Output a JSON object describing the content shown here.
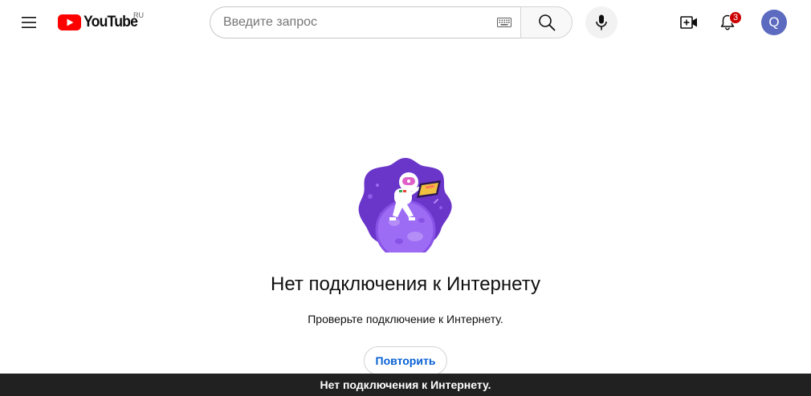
{
  "header": {
    "logo_text": "YouTube",
    "country_code": "RU",
    "search": {
      "placeholder": "Введите запрос",
      "value": ""
    },
    "notifications_count": "3",
    "avatar_letter": "Q"
  },
  "main": {
    "title": "Нет подключения к Интернету",
    "message": "Проверьте подключение к Интернету.",
    "retry_label": "Повторить"
  },
  "snackbar": {
    "text": "Нет подключения к Интернету."
  },
  "icons": {
    "menu": "hamburger-menu-icon",
    "keyboard": "keyboard-icon",
    "search": "search-icon",
    "mic": "microphone-icon",
    "create": "create-video-icon",
    "bell": "notifications-bell-icon"
  },
  "colors": {
    "brand_red": "#ff0000",
    "link_blue": "#065fd4",
    "badge_red": "#cc0000",
    "avatar_bg": "#5c6bc0",
    "illustration_purple": "#6a35c9",
    "snackbar_bg": "#212121"
  }
}
